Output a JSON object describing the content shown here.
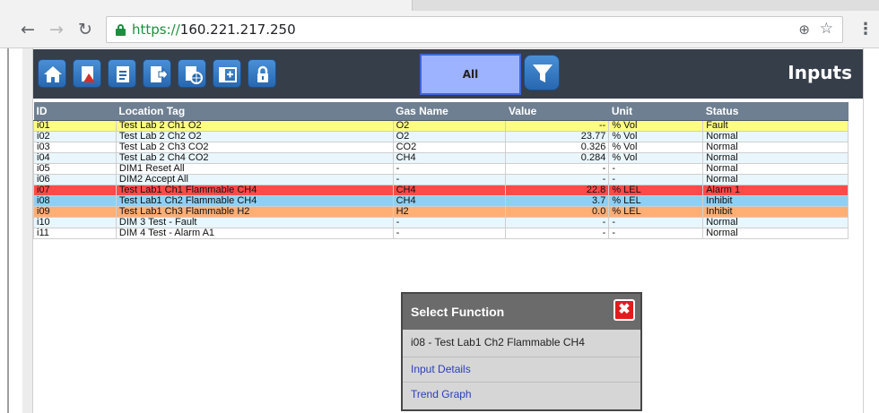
{
  "browser": {
    "back_icon": "arrow-left-icon",
    "forward_icon": "arrow-right-icon",
    "reload_icon": "reload-icon",
    "url_protocol": "https://",
    "url_host": "160.221.217.250",
    "zoom_icon": "zoom-icon",
    "bookmark_icon": "star-icon",
    "menu_icon": "kebab-menu-icon"
  },
  "toolbar": {
    "buttons": [
      "home-icon",
      "report-pdf-icon",
      "document-icon",
      "export-icon",
      "report-network-icon",
      "add-window-icon",
      "lock-icon"
    ],
    "filter_label": "All",
    "filter_icon": "funnel-icon",
    "title": "Inputs",
    "accent_color": "#9db3ff"
  },
  "table": {
    "headers": {
      "id": "ID",
      "location": "Location Tag",
      "gas": "Gas Name",
      "value": "Value",
      "unit": "Unit",
      "status": "Status"
    },
    "rows": [
      {
        "id": "i01",
        "location": "Test Lab 2 Ch1 O2",
        "gas": "O2",
        "value": "--",
        "unit": "% Vol",
        "status": "Fault",
        "color": "#ffff80"
      },
      {
        "id": "i02",
        "location": "Test Lab 2 Ch2 O2",
        "gas": "O2",
        "value": "23.77",
        "unit": "% Vol",
        "status": "Normal",
        "color": "#e9f6fc"
      },
      {
        "id": "i03",
        "location": "Test Lab 2 Ch3 CO2",
        "gas": "CO2",
        "value": "0.326",
        "unit": "% Vol",
        "status": "Normal",
        "color": "#ffffff"
      },
      {
        "id": "i04",
        "location": "Test Lab 2 Ch4 CO2",
        "gas": "CH4",
        "value": "0.284",
        "unit": "% Vol",
        "status": "Normal",
        "color": "#e9f6fc"
      },
      {
        "id": "i05",
        "location": "DIM1 Reset All",
        "gas": "-",
        "value": "-",
        "unit": "-",
        "status": "Normal",
        "color": "#ffffff"
      },
      {
        "id": "i06",
        "location": "DIM2 Accept All",
        "gas": "-",
        "value": "-",
        "unit": "-",
        "status": "Normal",
        "color": "#e9f6fc"
      },
      {
        "id": "i07",
        "location": "Test Lab1 Ch1 Flammable CH4",
        "gas": "CH4",
        "value": "22.8",
        "unit": "% LEL",
        "status": "Alarm 1",
        "color": "#ff4a4a"
      },
      {
        "id": "i08",
        "location": "Test Lab1 Ch2 Flammable CH4",
        "gas": "CH4",
        "value": "3.7",
        "unit": "% LEL",
        "status": "Inhibit",
        "color": "#8ed0f5"
      },
      {
        "id": "i09",
        "location": "Test Lab1 Ch3 Flammable H2",
        "gas": "H2",
        "value": "0.0",
        "unit": "% LEL",
        "status": "Inhibit",
        "color": "#ffae74"
      },
      {
        "id": "i10",
        "location": "DIM 3 Test - Fault",
        "gas": "-",
        "value": "-",
        "unit": "-",
        "status": "Normal",
        "color": "#e9f6fc"
      },
      {
        "id": "i11",
        "location": "DIM 4 Test - Alarm A1",
        "gas": "-",
        "value": "-",
        "unit": "-",
        "status": "Normal",
        "color": "#ffffff"
      }
    ]
  },
  "popup": {
    "title": "Select Function",
    "close_icon": "close-icon",
    "selected": "i08 - Test Lab1 Ch2 Flammable CH4",
    "items": [
      "Input Details",
      "Trend Graph"
    ]
  }
}
